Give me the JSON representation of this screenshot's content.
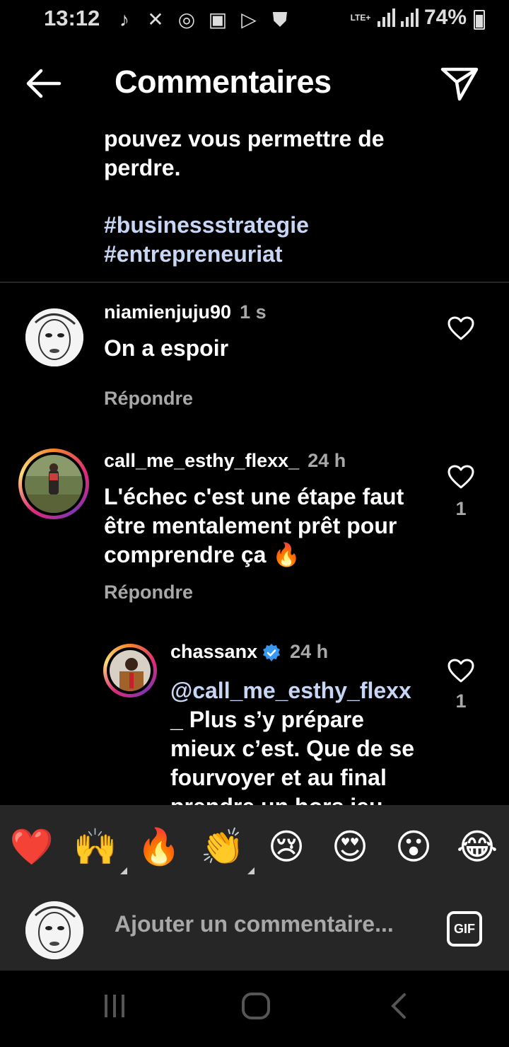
{
  "status_bar": {
    "time": "13:12",
    "network": "LTE+",
    "battery": "74%",
    "icons": [
      "tiktok-icon",
      "missed-call-icon",
      "instagram-icon",
      "gallery-icon",
      "play-icon",
      "shield-icon"
    ]
  },
  "header": {
    "title": "Commentaires"
  },
  "caption": {
    "line1": "pouvez vous permettre de",
    "line2": "perdre.",
    "hashtag1": "#businessstrategie",
    "hashtag2": "#entrepreneuriat"
  },
  "comments": [
    {
      "username": "niamienjuju90",
      "time": "1 s",
      "text": "On a espoir",
      "reply_label": "Répondre",
      "likes": ""
    },
    {
      "username": "call_me_esthy_flexx_",
      "time": "24 h",
      "text_line1": "L'échec c'est une étape faut",
      "text_line2": "être mentalement prêt pour",
      "text_line3": "comprendre ça 🔥",
      "reply_label": "Répondre",
      "likes": "1"
    },
    {
      "username": "chassanx",
      "verified": true,
      "time": "24 h",
      "mention": "@call_me_esthy_flexx",
      "text_line1": "_ Plus s’y prépare",
      "text_line2": "mieux c’est. Que de se",
      "text_line3": "fourvoyer et au final",
      "text_line4": "prendre un hors jeu",
      "likes": "1"
    }
  ],
  "emoji_bar": [
    "❤️",
    "🙌",
    "🔥",
    "👏",
    "😢",
    "😍",
    "😮",
    "😂"
  ],
  "compose": {
    "placeholder": "Ajouter un commentaire...",
    "gif_label": "GIF"
  },
  "colors": {
    "background": "#000000",
    "panel": "#262626",
    "secondary_text": "#a8a8a8",
    "link": "#c7d6f5",
    "verified": "#3897f0"
  }
}
